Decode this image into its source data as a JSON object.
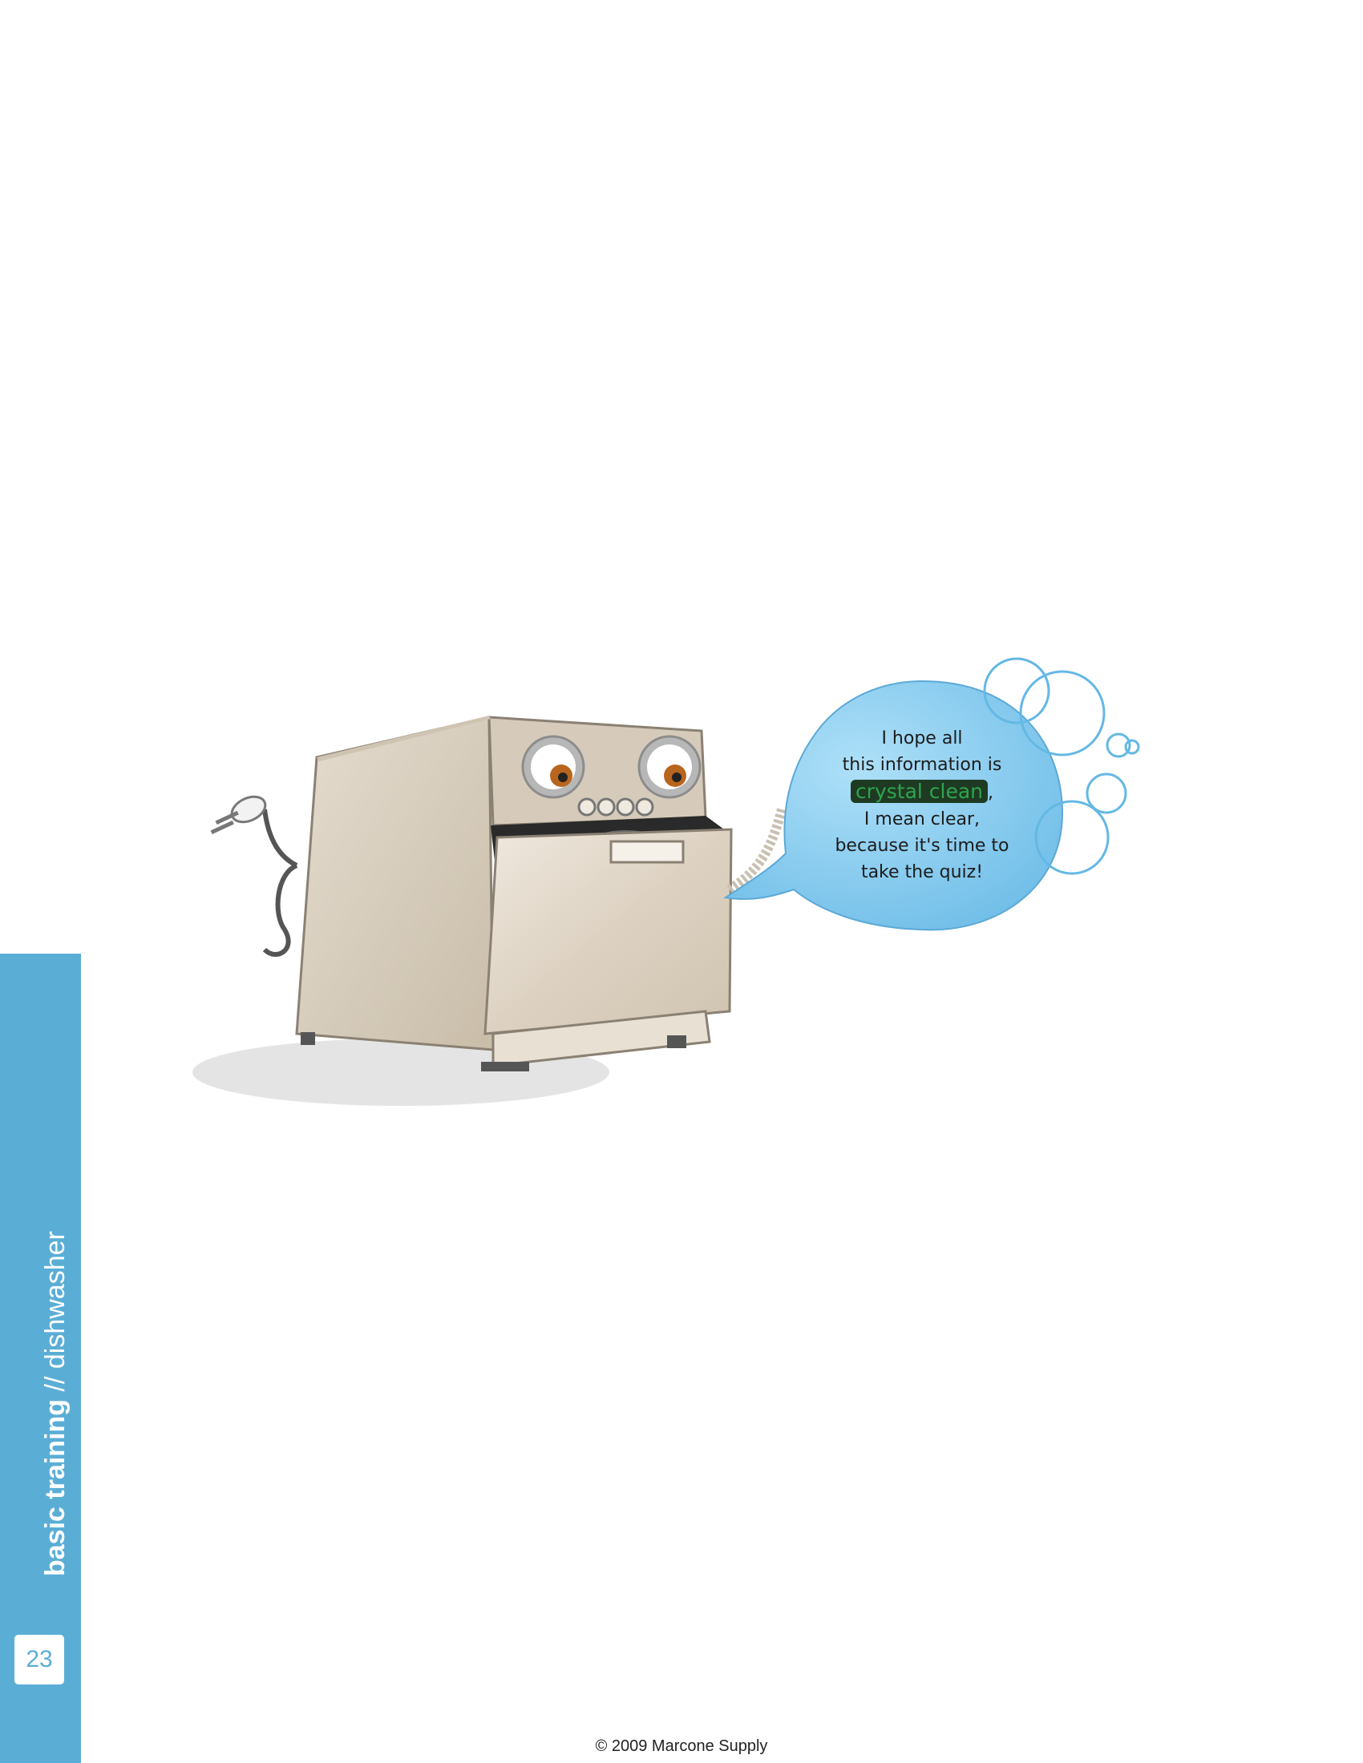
{
  "page": {
    "section_bold": "basic training",
    "section_separator": " // ",
    "section_light": "dishwasher",
    "page_number": "23",
    "footer": "© 2009 Marcone Supply"
  },
  "speech_bubble": {
    "line1": "I hope all",
    "line2": "this information is",
    "highlight": "crystal clean",
    "highlight_suffix": ",",
    "line4": "I mean clear,",
    "line5": "because it's time to",
    "line6": "take the quiz!"
  },
  "colors": {
    "tab_blue": "#5aaed6",
    "bubble_blue": "#7cc4ec",
    "highlight_green": "#2ea44f",
    "appliance_beige": "#d9cfc0"
  }
}
